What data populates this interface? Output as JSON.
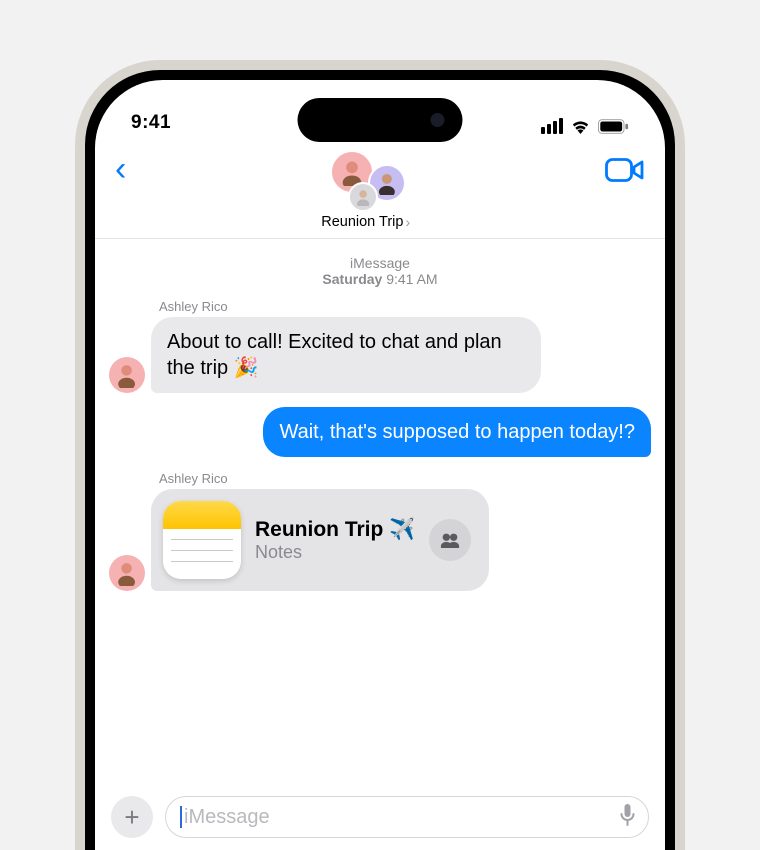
{
  "status": {
    "time": "9:41"
  },
  "nav": {
    "group_name": "Reunion Trip"
  },
  "thread": {
    "service": "iMessage",
    "date_label": "Saturday",
    "time_label": "9:41 AM",
    "messages": [
      {
        "sender": "Ashley Rico",
        "text": "About to call! Excited to chat and plan the trip 🎉",
        "outgoing": false
      },
      {
        "text": "Wait, that's supposed to happen today!?",
        "outgoing": true
      },
      {
        "sender": "Ashley Rico",
        "attachment": {
          "title": "Reunion Trip ✈️",
          "source": "Notes"
        },
        "outgoing": false
      }
    ]
  },
  "compose": {
    "placeholder": "iMessage"
  }
}
